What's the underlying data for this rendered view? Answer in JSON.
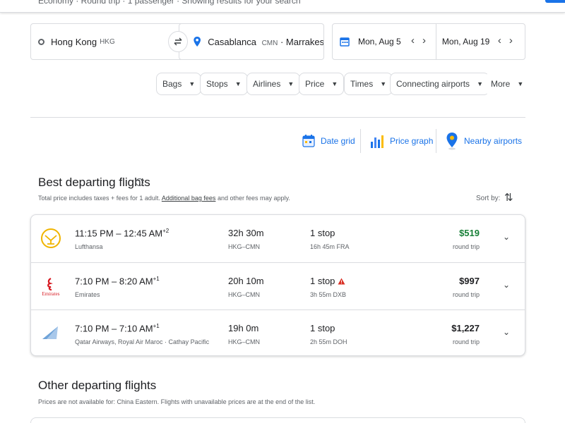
{
  "top_bar": {
    "text": "Economy · Round trip · 1 passenger · Showing results for your search"
  },
  "search": {
    "origin": {
      "city": "Hong Kong",
      "code": "HKG"
    },
    "destination": {
      "city": "Casablanca",
      "code": "CMN",
      "extra": "· Marrakesh ..."
    },
    "depart_date": "Mon, Aug 5",
    "return_date": "Mon, Aug 19"
  },
  "filters": [
    "Bags",
    "Stops",
    "Airlines",
    "Price",
    "Times",
    "Connecting airports",
    "More"
  ],
  "tools": {
    "date_grid": "Date grid",
    "price_graph": "Price graph",
    "nearby_airports": "Nearby airports"
  },
  "best": {
    "title": "Best departing flights",
    "note_prefix": "Total price includes taxes + fees for 1 adult.",
    "note_link": "Additional bag fees",
    "note_suffix": "and other fees may apply.",
    "sort_label": "Sort by:"
  },
  "flights": [
    {
      "dep": "11:15 PM",
      "arr": "12:45 AM",
      "day_offset": "+2",
      "airline": "Lufthansa",
      "operator": "",
      "duration": "32h 30m",
      "route": "HKG–CMN",
      "stops": "1 stop",
      "warning": false,
      "stop_detail": "16h 45m FRA",
      "price": "$519",
      "price_highlight": true,
      "trip_type": "round trip",
      "logo": "lufthansa-logo"
    },
    {
      "dep": "7:10 PM",
      "arr": "8:20 AM",
      "day_offset": "+1",
      "airline": "Emirates",
      "operator": "",
      "duration": "20h 10m",
      "route": "HKG–CMN",
      "stops": "1 stop",
      "warning": true,
      "stop_detail": "3h 55m DXB",
      "price": "$997",
      "price_highlight": false,
      "trip_type": "round trip",
      "logo": "emirates-logo",
      "logo_text": "Emirates"
    },
    {
      "dep": "7:10 PM",
      "arr": "7:10 AM",
      "day_offset": "+1",
      "airline": "Qatar Airways, Royal Air Maroc",
      "operator": "Cathay Pacific",
      "duration": "19h 0m",
      "route": "HKG–CMN",
      "stops": "1 stop",
      "warning": false,
      "stop_detail": "2h 55m DOH",
      "price": "$1,227",
      "price_highlight": false,
      "trip_type": "round trip",
      "logo": "cathay-logo"
    }
  ],
  "other": {
    "title": "Other departing flights",
    "note": "Prices are not available for: China Eastern. Flights with unavailable prices are at the end of the list."
  },
  "colors": {
    "accent": "#1a73e8",
    "price_green": "#188038",
    "warning_red": "#d93025"
  }
}
